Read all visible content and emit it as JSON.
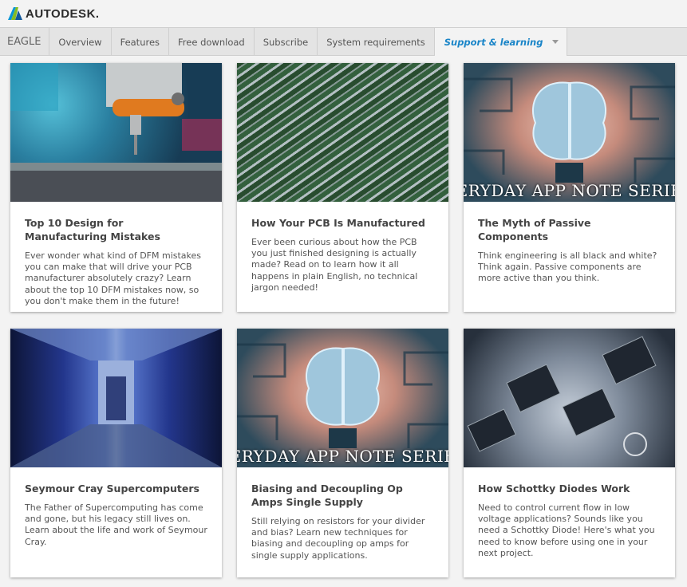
{
  "brand": {
    "logo_text": "AUTODESK."
  },
  "nav": {
    "product": "EAGLE",
    "items": [
      "Overview",
      "Features",
      "Free download",
      "Subscribe",
      "System requirements"
    ],
    "active": "Support & learning"
  },
  "cards": [
    {
      "title": "Top 10 Design for Manufacturing Mistakes",
      "desc": "Ever wonder what kind of DFM mistakes you can make that will drive your PCB manufacturer absolutely crazy? Learn about the top 10 DFM mistakes now, so you don't make them in the future!",
      "image": "cnc-drill-pcb"
    },
    {
      "title": "How Your PCB Is Manufactured",
      "desc": "Ever been curious about how the PCB you just finished designing is actually made? Read on to learn how it all happens in plain English, no technical jargon needed!",
      "image": "pcb-rows"
    },
    {
      "title": "The Myth of Passive Components",
      "desc": "Think engineering is all black and white? Think again. Passive components are more active than you think.",
      "image": "brain-circuit",
      "banner": "ERYDAY APP NOTE SERIE"
    },
    {
      "title": "Seymour Cray Supercomputers",
      "desc": "The Father of Supercomputing has come and gone, but his legacy still lives on. Learn about the life and work of Seymour Cray.",
      "image": "server-room"
    },
    {
      "title": "Biasing and Decoupling Op Amps Single Supply",
      "desc": "Still relying on resistors for your divider and bias? Learn new techniques for biasing and decoupling op amps for single supply applications.",
      "image": "brain-circuit",
      "banner": "ERYDAY APP NOTE SERIE"
    },
    {
      "title": "How Schottky Diodes Work",
      "desc": "Need to control current flow in low voltage applications? Sounds like you need a Schottky Diode! Here's what you need to know before using one in your next project.",
      "image": "schottky-diodes"
    }
  ]
}
